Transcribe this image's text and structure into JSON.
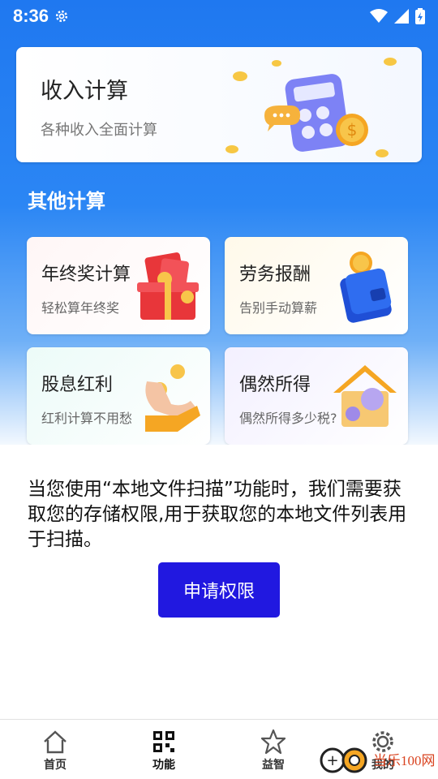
{
  "status_bar": {
    "time": "8:36"
  },
  "income_card": {
    "title": "收入计算",
    "subtitle": "各种收入全面计算"
  },
  "section": {
    "title": "其他计算"
  },
  "tiles": [
    {
      "title": "年终奖计算",
      "subtitle": "轻松算年终奖",
      "icon": "red-envelope-gift-icon"
    },
    {
      "title": "劳务报酬",
      "subtitle": "告别手动算薪",
      "icon": "wallet-coin-icon"
    },
    {
      "title": "股息红利",
      "subtitle": "红利计算不用愁",
      "icon": "hand-coins-icon"
    },
    {
      "title": "偶然所得",
      "subtitle": "偶然所得多少税?",
      "icon": "tax-house-icon"
    }
  ],
  "permission": {
    "message": "当您使用“本地文件扫描”功能时，我们需要获取您的存储权限,用于获取您的本地文件列表用于扫描。",
    "button_label": "申请权限"
  },
  "bottom_nav": [
    {
      "label": "首页",
      "icon": "home-icon"
    },
    {
      "label": "功能",
      "icon": "qr-code-icon"
    },
    {
      "label": "益智",
      "icon": "star-icon"
    },
    {
      "label": "我的",
      "icon": "gear-icon"
    }
  ],
  "watermark": {
    "text": "当乐100网"
  },
  "colors": {
    "primary": "#2118e0",
    "header_blue": "#1f78f0"
  }
}
